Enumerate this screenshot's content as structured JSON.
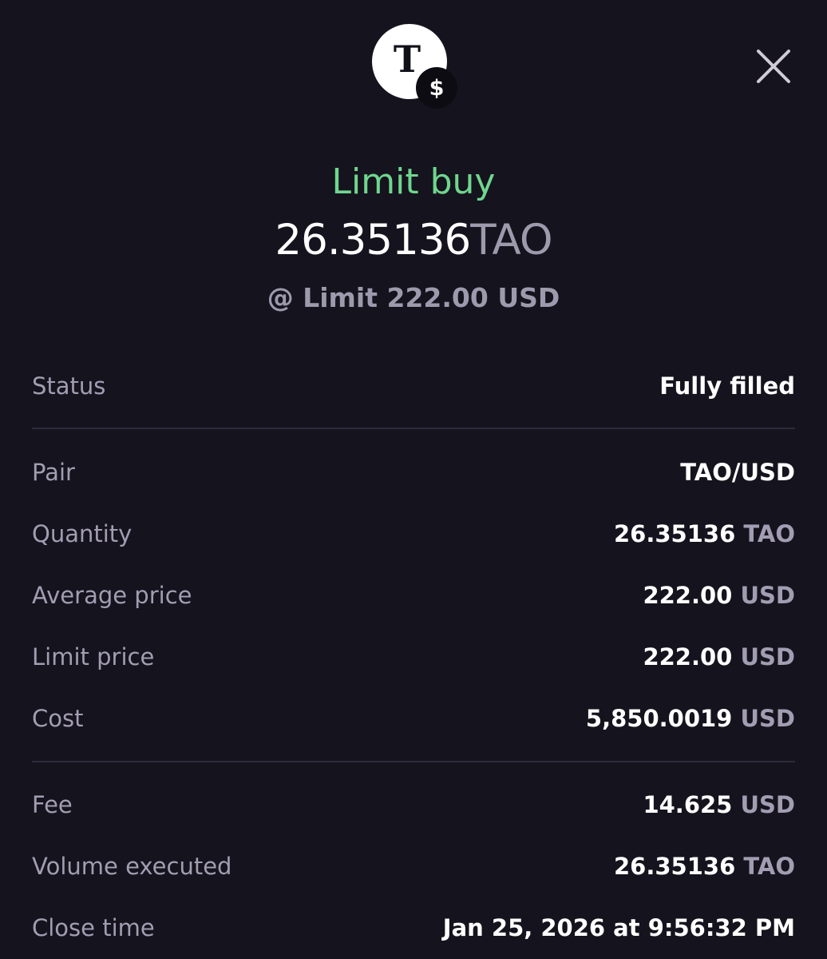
{
  "header": {
    "token_glyph": "T",
    "badge_glyph": "$",
    "close_glyph": "×"
  },
  "order": {
    "type": "Limit buy",
    "amount": "26.35136",
    "amount_unit": "TAO",
    "limit_text": "@ Limit 222.00 USD"
  },
  "details": {
    "status": {
      "label": "Status",
      "value": "Fully filled"
    },
    "pair": {
      "label": "Pair",
      "value": "TAO/USD"
    },
    "quantity": {
      "label": "Quantity",
      "value": "26.35136",
      "unit": "TAO"
    },
    "average_price": {
      "label": "Average price",
      "value": "222.00",
      "unit": "USD"
    },
    "limit_price": {
      "label": "Limit price",
      "value": "222.00",
      "unit": "USD"
    },
    "cost": {
      "label": "Cost",
      "value": "5,850.0019",
      "unit": "USD"
    },
    "fee": {
      "label": "Fee",
      "value": "14.625",
      "unit": "USD"
    },
    "volume_executed": {
      "label": "Volume executed",
      "value": "26.35136",
      "unit": "TAO"
    },
    "close_time": {
      "label": "Close time",
      "value": "Jan 25, 2026 at 9:56:32 PM"
    }
  },
  "icons": {
    "token": "tao-token-icon",
    "badge": "usd-badge-icon",
    "close": "close-icon"
  },
  "colors": {
    "background": "#15131d",
    "accent_green": "#6fd68e",
    "muted_text": "#a29db2",
    "divider": "#2f2b3c"
  }
}
